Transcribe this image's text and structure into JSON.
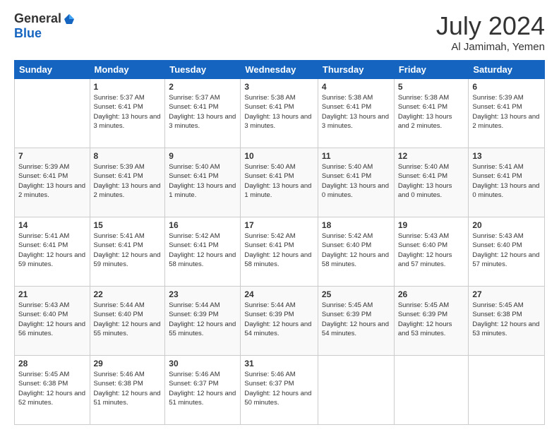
{
  "header": {
    "logo_general": "General",
    "logo_blue": "Blue",
    "month_year": "July 2024",
    "location": "Al Jamimah, Yemen"
  },
  "days_of_week": [
    "Sunday",
    "Monday",
    "Tuesday",
    "Wednesday",
    "Thursday",
    "Friday",
    "Saturday"
  ],
  "weeks": [
    [
      {
        "day": "",
        "sunrise": "",
        "sunset": "",
        "daylight": ""
      },
      {
        "day": "1",
        "sunrise": "Sunrise: 5:37 AM",
        "sunset": "Sunset: 6:41 PM",
        "daylight": "Daylight: 13 hours and 3 minutes."
      },
      {
        "day": "2",
        "sunrise": "Sunrise: 5:37 AM",
        "sunset": "Sunset: 6:41 PM",
        "daylight": "Daylight: 13 hours and 3 minutes."
      },
      {
        "day": "3",
        "sunrise": "Sunrise: 5:38 AM",
        "sunset": "Sunset: 6:41 PM",
        "daylight": "Daylight: 13 hours and 3 minutes."
      },
      {
        "day": "4",
        "sunrise": "Sunrise: 5:38 AM",
        "sunset": "Sunset: 6:41 PM",
        "daylight": "Daylight: 13 hours and 3 minutes."
      },
      {
        "day": "5",
        "sunrise": "Sunrise: 5:38 AM",
        "sunset": "Sunset: 6:41 PM",
        "daylight": "Daylight: 13 hours and 2 minutes."
      },
      {
        "day": "6",
        "sunrise": "Sunrise: 5:39 AM",
        "sunset": "Sunset: 6:41 PM",
        "daylight": "Daylight: 13 hours and 2 minutes."
      }
    ],
    [
      {
        "day": "7",
        "sunrise": "Sunrise: 5:39 AM",
        "sunset": "Sunset: 6:41 PM",
        "daylight": "Daylight: 13 hours and 2 minutes."
      },
      {
        "day": "8",
        "sunrise": "Sunrise: 5:39 AM",
        "sunset": "Sunset: 6:41 PM",
        "daylight": "Daylight: 13 hours and 2 minutes."
      },
      {
        "day": "9",
        "sunrise": "Sunrise: 5:40 AM",
        "sunset": "Sunset: 6:41 PM",
        "daylight": "Daylight: 13 hours and 1 minute."
      },
      {
        "day": "10",
        "sunrise": "Sunrise: 5:40 AM",
        "sunset": "Sunset: 6:41 PM",
        "daylight": "Daylight: 13 hours and 1 minute."
      },
      {
        "day": "11",
        "sunrise": "Sunrise: 5:40 AM",
        "sunset": "Sunset: 6:41 PM",
        "daylight": "Daylight: 13 hours and 0 minutes."
      },
      {
        "day": "12",
        "sunrise": "Sunrise: 5:40 AM",
        "sunset": "Sunset: 6:41 PM",
        "daylight": "Daylight: 13 hours and 0 minutes."
      },
      {
        "day": "13",
        "sunrise": "Sunrise: 5:41 AM",
        "sunset": "Sunset: 6:41 PM",
        "daylight": "Daylight: 13 hours and 0 minutes."
      }
    ],
    [
      {
        "day": "14",
        "sunrise": "Sunrise: 5:41 AM",
        "sunset": "Sunset: 6:41 PM",
        "daylight": "Daylight: 12 hours and 59 minutes."
      },
      {
        "day": "15",
        "sunrise": "Sunrise: 5:41 AM",
        "sunset": "Sunset: 6:41 PM",
        "daylight": "Daylight: 12 hours and 59 minutes."
      },
      {
        "day": "16",
        "sunrise": "Sunrise: 5:42 AM",
        "sunset": "Sunset: 6:41 PM",
        "daylight": "Daylight: 12 hours and 58 minutes."
      },
      {
        "day": "17",
        "sunrise": "Sunrise: 5:42 AM",
        "sunset": "Sunset: 6:41 PM",
        "daylight": "Daylight: 12 hours and 58 minutes."
      },
      {
        "day": "18",
        "sunrise": "Sunrise: 5:42 AM",
        "sunset": "Sunset: 6:40 PM",
        "daylight": "Daylight: 12 hours and 58 minutes."
      },
      {
        "day": "19",
        "sunrise": "Sunrise: 5:43 AM",
        "sunset": "Sunset: 6:40 PM",
        "daylight": "Daylight: 12 hours and 57 minutes."
      },
      {
        "day": "20",
        "sunrise": "Sunrise: 5:43 AM",
        "sunset": "Sunset: 6:40 PM",
        "daylight": "Daylight: 12 hours and 57 minutes."
      }
    ],
    [
      {
        "day": "21",
        "sunrise": "Sunrise: 5:43 AM",
        "sunset": "Sunset: 6:40 PM",
        "daylight": "Daylight: 12 hours and 56 minutes."
      },
      {
        "day": "22",
        "sunrise": "Sunrise: 5:44 AM",
        "sunset": "Sunset: 6:40 PM",
        "daylight": "Daylight: 12 hours and 55 minutes."
      },
      {
        "day": "23",
        "sunrise": "Sunrise: 5:44 AM",
        "sunset": "Sunset: 6:39 PM",
        "daylight": "Daylight: 12 hours and 55 minutes."
      },
      {
        "day": "24",
        "sunrise": "Sunrise: 5:44 AM",
        "sunset": "Sunset: 6:39 PM",
        "daylight": "Daylight: 12 hours and 54 minutes."
      },
      {
        "day": "25",
        "sunrise": "Sunrise: 5:45 AM",
        "sunset": "Sunset: 6:39 PM",
        "daylight": "Daylight: 12 hours and 54 minutes."
      },
      {
        "day": "26",
        "sunrise": "Sunrise: 5:45 AM",
        "sunset": "Sunset: 6:39 PM",
        "daylight": "Daylight: 12 hours and 53 minutes."
      },
      {
        "day": "27",
        "sunrise": "Sunrise: 5:45 AM",
        "sunset": "Sunset: 6:38 PM",
        "daylight": "Daylight: 12 hours and 53 minutes."
      }
    ],
    [
      {
        "day": "28",
        "sunrise": "Sunrise: 5:45 AM",
        "sunset": "Sunset: 6:38 PM",
        "daylight": "Daylight: 12 hours and 52 minutes."
      },
      {
        "day": "29",
        "sunrise": "Sunrise: 5:46 AM",
        "sunset": "Sunset: 6:38 PM",
        "daylight": "Daylight: 12 hours and 51 minutes."
      },
      {
        "day": "30",
        "sunrise": "Sunrise: 5:46 AM",
        "sunset": "Sunset: 6:37 PM",
        "daylight": "Daylight: 12 hours and 51 minutes."
      },
      {
        "day": "31",
        "sunrise": "Sunrise: 5:46 AM",
        "sunset": "Sunset: 6:37 PM",
        "daylight": "Daylight: 12 hours and 50 minutes."
      },
      {
        "day": "",
        "sunrise": "",
        "sunset": "",
        "daylight": ""
      },
      {
        "day": "",
        "sunrise": "",
        "sunset": "",
        "daylight": ""
      },
      {
        "day": "",
        "sunrise": "",
        "sunset": "",
        "daylight": ""
      }
    ]
  ]
}
